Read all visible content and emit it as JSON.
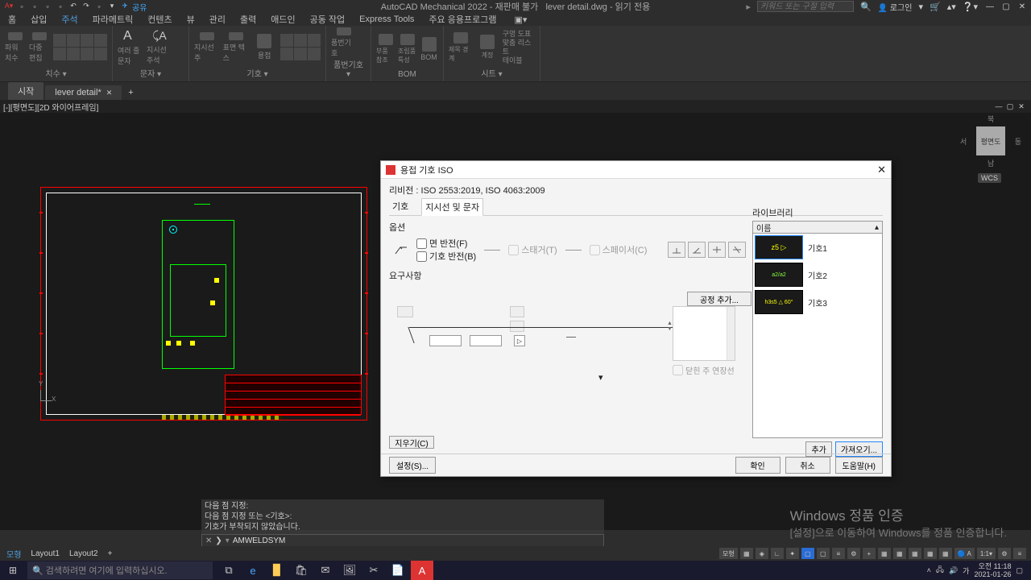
{
  "titlebar": {
    "share": "공유",
    "title_app": "AutoCAD Mechanical 2022 - 재판매 불가",
    "title_file": "lever detail.dwg",
    "title_mode": "읽기 전용",
    "search_placeholder": "키워드 또는 구절 입력",
    "login": "로그인"
  },
  "menu": {
    "tabs": [
      "홈",
      "삽입",
      "주석",
      "파라메트릭",
      "컨텐츠",
      "뷰",
      "관리",
      "출력",
      "애드인",
      "공동 작업",
      "Express Tools",
      "주요 응용프로그램"
    ],
    "active_index": 2
  },
  "ribbon": {
    "panels": [
      {
        "label": "치수 ▾",
        "items": [
          "파워 치수",
          "다중 편집"
        ]
      },
      {
        "label": "문자 ▾",
        "items": [
          "여러 줄 문자",
          "지시선 주석"
        ]
      },
      {
        "label": "기호 ▾",
        "items": [
          "지시선 주",
          "표면 텍스",
          "용접"
        ]
      },
      {
        "label": "품번기호 ▾",
        "items": [
          "품번기호"
        ]
      },
      {
        "label": "BOM",
        "items": [
          "부품 참조",
          "조립품 특성",
          "BOM"
        ]
      },
      {
        "label": "시트 ▾",
        "items": [
          "제목 경계",
          "계정",
          "구멍 도표",
          "맞춤 리스트",
          "테이블"
        ]
      }
    ]
  },
  "doctabs": {
    "tabs": [
      {
        "label": "시작"
      },
      {
        "label": "lever detail*",
        "close": true
      }
    ],
    "active": 1
  },
  "viewport": {
    "label": "[-][평면도][2D 와이어프레임]"
  },
  "navcube": {
    "face": "평면도",
    "n": "북",
    "s": "남",
    "e": "동",
    "w": "서",
    "wcs": "WCS"
  },
  "cmd": {
    "hist": [
      "다음 점 지정:",
      "다음 점 지정 또는 <기호>:",
      "기호가 부착되지 않았습니다."
    ],
    "prompt": "AMWELDSYM"
  },
  "watermark": {
    "line1": "Windows 정품 인증",
    "line2": "[설정]으로 이동하여 Windows를 정품 인증합니다."
  },
  "layouttabs": {
    "tabs": [
      "모형",
      "Layout1",
      "Layout2"
    ],
    "active": 0,
    "status_model": "모형"
  },
  "taskbar": {
    "search": "검색하려면 여기에 입력하십시오.",
    "time": "오전 11:18",
    "date": "2021-01-26"
  },
  "dialog": {
    "title": "용접 기호 ISO",
    "revision": "리비전 : ISO 2553:2019, ISO 4063:2009",
    "tab1": "기호",
    "tab2": "지시선 및 문자",
    "options_label": "옵션",
    "flip_face": "면 반전(F)",
    "flip_symbol": "기호 반전(B)",
    "stagger": "스태거(T)",
    "spacer": "스페이서(C)",
    "requirements": "요구사항",
    "process_add": "공정 추가...",
    "closed_tail": "닫힌 주 연장선",
    "clear": "지우기(C)",
    "settings": "설정(S)...",
    "ok": "확인",
    "cancel": "취소",
    "help": "도움말(H)",
    "library": {
      "header": "라이브러리",
      "col": "이름",
      "items": [
        {
          "thumb": "z5 ▷",
          "name": "기호1"
        },
        {
          "thumb": "a2/a2",
          "name": "기호2"
        },
        {
          "thumb": "h3s5 △ 60°",
          "name": "기호3"
        }
      ],
      "add": "추가",
      "import": "가져오기..."
    }
  }
}
